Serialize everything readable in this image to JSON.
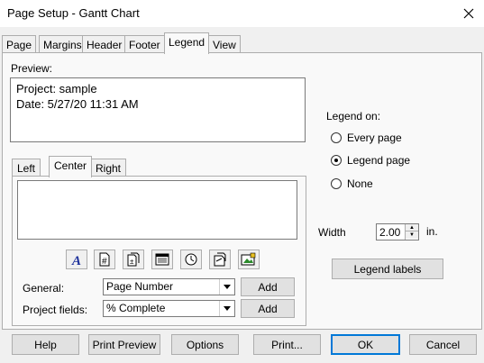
{
  "window": {
    "title": "Page Setup - Gantt Chart"
  },
  "tabs": [
    {
      "label": "Page"
    },
    {
      "label": "Margins"
    },
    {
      "label": "Header"
    },
    {
      "label": "Footer"
    },
    {
      "label": "Legend",
      "active": true
    },
    {
      "label": "View"
    }
  ],
  "preview": {
    "label": "Preview:",
    "lines": [
      "Project: sample",
      "Date: 5/27/20 11:31 AM"
    ]
  },
  "subtabs": [
    {
      "label": "Left"
    },
    {
      "label": "Center",
      "active": true
    },
    {
      "label": "Right"
    }
  ],
  "toolbar": {
    "icons": [
      "font-icon",
      "page-number-icon",
      "total-pages-icon",
      "date-icon",
      "time-icon",
      "file-name-icon",
      "picture-icon"
    ]
  },
  "general": {
    "label": "General:",
    "value": "Page Number",
    "add_label": "Add"
  },
  "project_fields": {
    "label": "Project fields:",
    "value": "% Complete",
    "add_label": "Add"
  },
  "legend_on": {
    "label": "Legend on:",
    "options": [
      {
        "label": "Every page",
        "checked": false
      },
      {
        "label": "Legend page",
        "checked": true
      },
      {
        "label": "None",
        "checked": false
      }
    ]
  },
  "width": {
    "label": "Width",
    "value": "2.00",
    "unit": "in."
  },
  "legend_labels_button": "Legend labels",
  "footer_buttons": {
    "help": "Help",
    "print_preview": "Print Preview",
    "options": "Options",
    "print": "Print...",
    "ok": "OK",
    "cancel": "Cancel"
  }
}
